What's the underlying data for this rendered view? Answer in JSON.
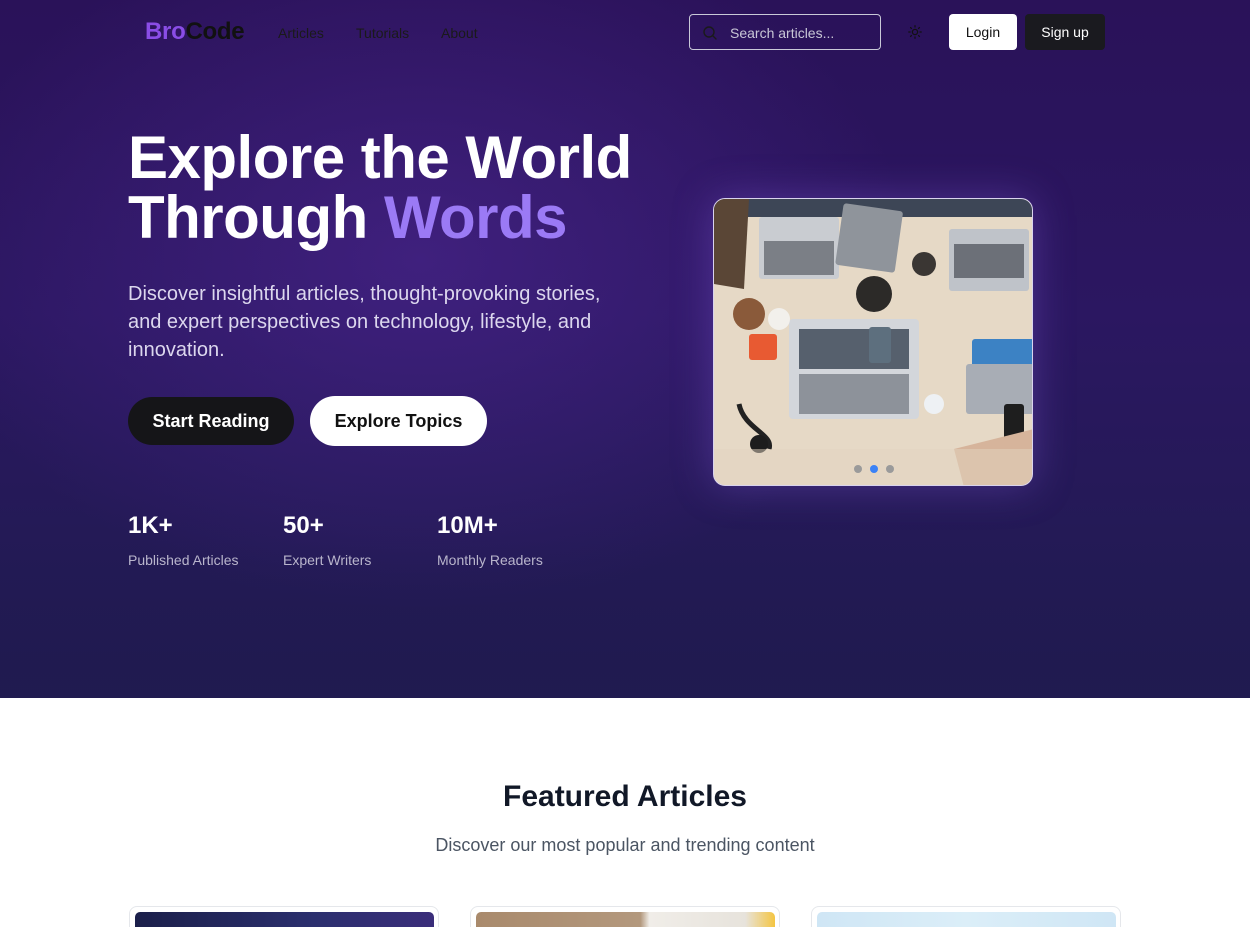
{
  "brand": {
    "part1": "Bro",
    "part2": "Code"
  },
  "nav": {
    "links": [
      "Articles",
      "Tutorials",
      "About"
    ],
    "search_placeholder": "Search articles...",
    "login_label": "Login",
    "signup_label": "Sign up"
  },
  "hero": {
    "title_line1": "Explore the World",
    "title_line2_plain": "Through",
    "title_line2_accent": "Words",
    "description": "Discover insightful articles, thought-provoking stories, and expert perspectives on technology, lifestyle, and innovation.",
    "primary_cta": "Start Reading",
    "secondary_cta": "Explore Topics",
    "stats": [
      {
        "value": "1K+",
        "label": "Published Articles"
      },
      {
        "value": "50+",
        "label": "Expert Writers"
      },
      {
        "value": "10M+",
        "label": "Monthly Readers"
      }
    ],
    "carousel": {
      "slide_count": 3,
      "active_index": 1
    }
  },
  "featured": {
    "title": "Featured Articles",
    "subtitle": "Discover our most popular and trending content"
  },
  "colors": {
    "brand_purple": "#8a4de6",
    "accent_lavender": "#9b7af5",
    "hero_bg": "#2a1259",
    "active_dot": "#3b82f6"
  }
}
